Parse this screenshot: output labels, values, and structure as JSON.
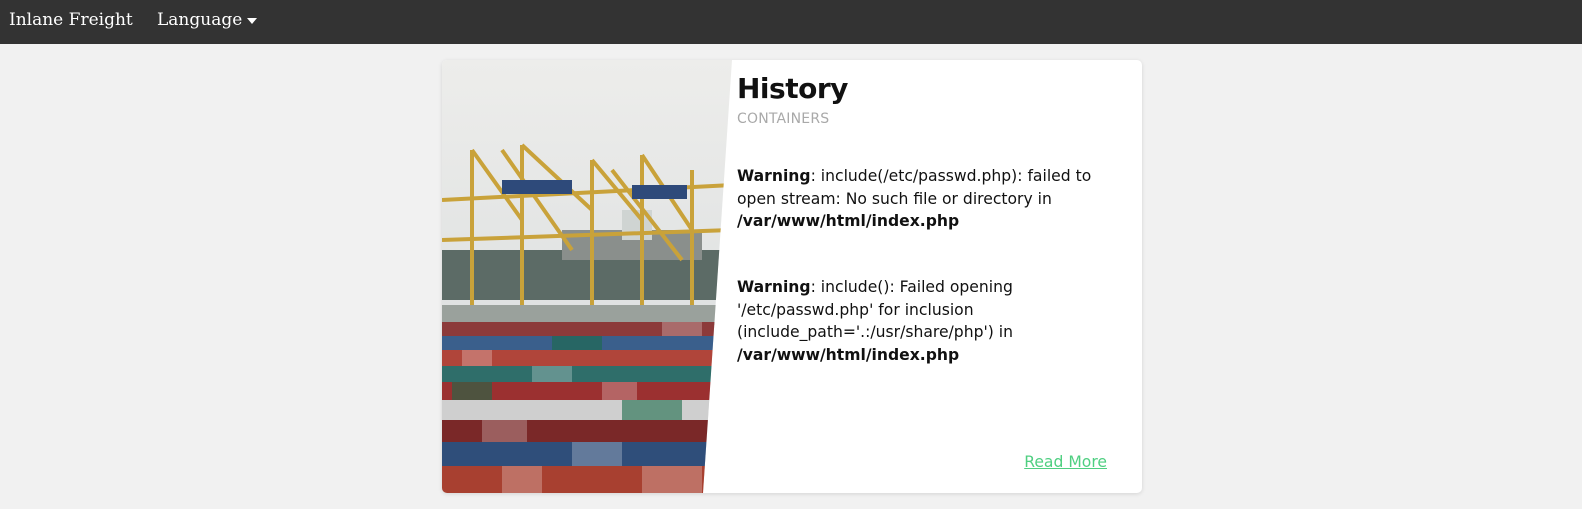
{
  "navbar": {
    "brand": "Inlane Freight",
    "language_label": "Language",
    "language_icon": "caret-down-icon"
  },
  "card": {
    "image_alt": "Shipping containers and cranes at port",
    "title": "History",
    "subtitle": "CONTAINERS",
    "warnings": [
      {
        "label": "Warning",
        "text": ": include(/etc/passwd.php): failed to open stream: No such file or directory in ",
        "path": "/var/www/html/index.php"
      },
      {
        "label": "Warning",
        "text": ": include(): Failed opening '/etc/passwd.php' for inclusion (include_path='.:/usr/share/php') in ",
        "path": "/var/www/html/index.php"
      }
    ],
    "read_more": "Read More"
  },
  "colors": {
    "navbar_bg": "#333333",
    "page_bg": "#f1f1f1",
    "link_green": "#4fcf81",
    "subtitle_gray": "#a9a9a9"
  }
}
